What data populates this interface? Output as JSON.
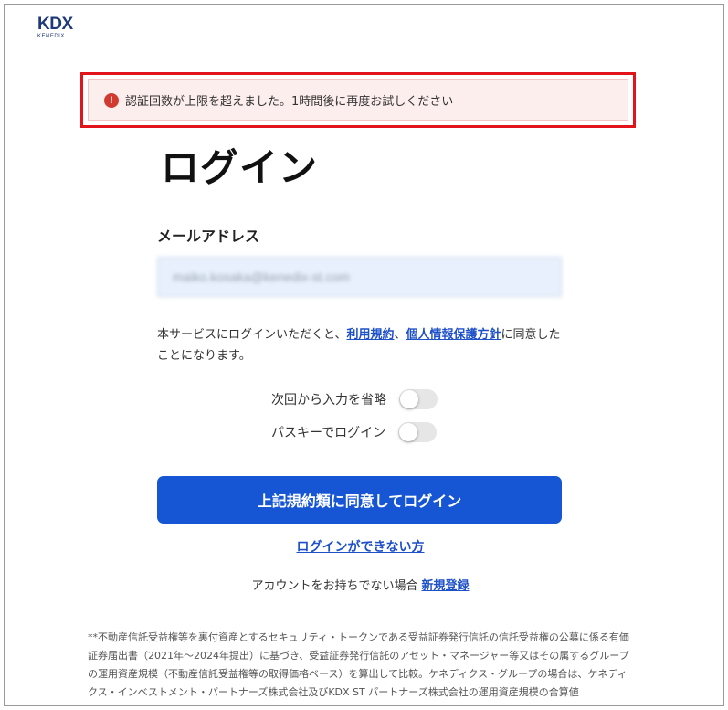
{
  "brand": {
    "logo_main": "KDX",
    "logo_sub": "KENEDIX",
    "color": "#1e3a78"
  },
  "alert": {
    "icon": "exclamation-circle-icon",
    "icon_glyph": "!",
    "message": "認証回数が上限を超えました。1時間後に再度お試しください",
    "color": "#d13b2f"
  },
  "login": {
    "title": "ログイン",
    "email_label": "メールアドレス",
    "email_value": "maiko.kosaka@kenedix-st.com"
  },
  "terms": {
    "before": "本サービスにログインいただくと、",
    "terms_link": "利用規約",
    "separator": "、",
    "privacy_link": "個人情報保護方針",
    "after": "に同意したことになります。"
  },
  "options": {
    "skip_input_label": "次回から入力を省略",
    "skip_input_enabled": false,
    "passkey_label": "パスキーでログイン",
    "passkey_enabled": false
  },
  "actions": {
    "submit_label": "上記規約類に同意してログイン",
    "submit_color": "#1656d4",
    "cant_login_label": "ログインができない方",
    "no_account_text": "アカウントをお持ちでない場合",
    "register_label": "新規登録",
    "link_color": "#1e50c8"
  },
  "disclaimer": {
    "text": "**不動産信託受益権等を裏付資産とするセキュリティ・トークンである受益証券発行信託の信託受益権の公募に係る有価証券届出書（2021年〜2024年提出）に基づき、受益証券発行信託のアセット・マネージャー等又はその属するグループの運用資産規模（不動産信託受益権等の取得価格ベース）を算出して比較。ケネディクス・グループの場合は、ケネディクス・インベストメント・パートナーズ株式会社及びKDX ST パートナーズ株式会社の運用資産規模の合算値"
  }
}
